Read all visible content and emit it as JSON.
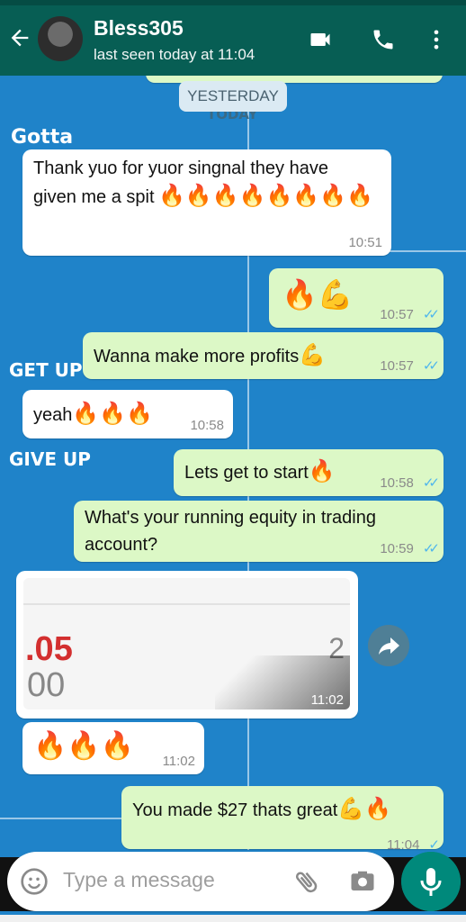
{
  "header": {
    "contact_name": "Bless305",
    "status": "last seen today at 11:04",
    "icons": [
      "back-arrow-icon",
      "video-call-icon",
      "phone-icon",
      "more-vert-icon"
    ]
  },
  "date_chip": "YESTERDAY",
  "wallpaper_text": {
    "today": "TODAY",
    "gotta": "Gotta",
    "get_up": "GET UP",
    "give_up": "GIVE UP"
  },
  "messages": [
    {
      "text": "Thank yuo for yuor singnal they have given me a spit",
      "emoji": "🔥🔥🔥🔥🔥🔥🔥🔥",
      "time": "10:51",
      "dir": "in"
    },
    {
      "text": "",
      "emoji": "🔥💪",
      "time": "10:57",
      "dir": "out",
      "read": true
    },
    {
      "text": "Wanna make more profits",
      "emoji": "💪",
      "time": "10:57",
      "dir": "out",
      "read": true
    },
    {
      "text": "yeah",
      "emoji": "🔥🔥🔥",
      "time": "10:58",
      "dir": "in"
    },
    {
      "text": "Lets get to start",
      "emoji": "🔥",
      "time": "10:58",
      "dir": "out",
      "read": true
    },
    {
      "text": "What's your running equity in trading account?",
      "emoji": "",
      "time": "10:59",
      "dir": "out",
      "read": true
    },
    {
      "text": "",
      "image": {
        "value_a": ".05",
        "value_b": "00",
        "value_c": "2"
      },
      "time": "11:02",
      "dir": "in"
    },
    {
      "text": "",
      "emoji": "🔥🔥🔥",
      "time": "11:02",
      "dir": "in"
    },
    {
      "text": "You made $27 thats great",
      "emoji": "💪🔥",
      "time": "11:04",
      "dir": "out",
      "read": true
    }
  ],
  "input": {
    "placeholder": "Type a message"
  },
  "colors": {
    "header": "#075e54",
    "incoming": "#ffffff",
    "outgoing": "#dcf8c6",
    "wallpaper": "#1f83c9",
    "read_ticks": "#4fb6ec",
    "mic": "#00897b"
  }
}
